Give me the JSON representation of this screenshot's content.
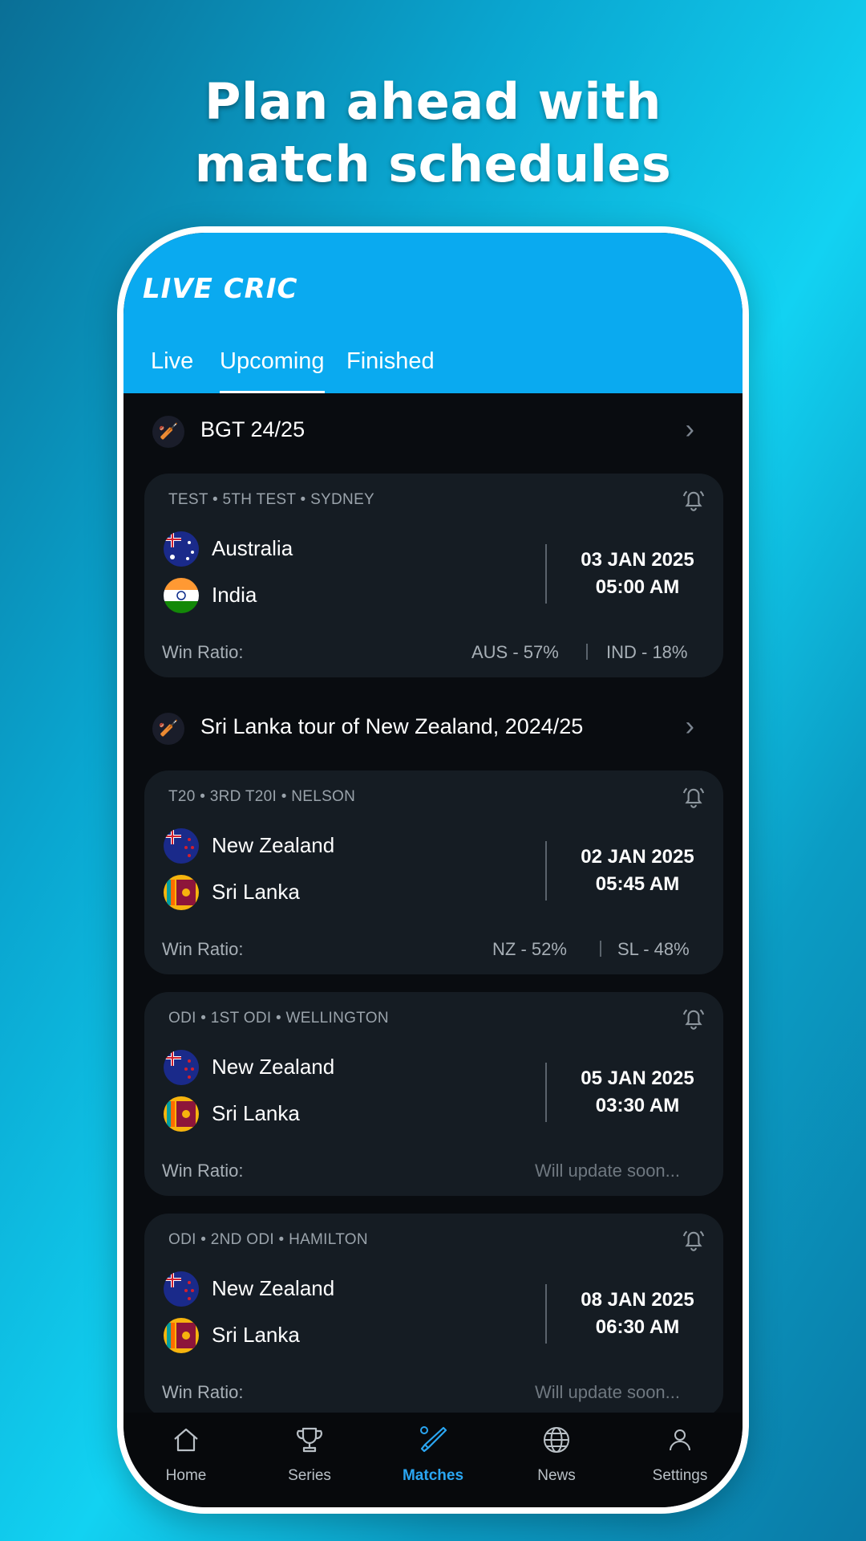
{
  "promo": {
    "headline_line1": "Plan ahead with",
    "headline_line2": "match schedules"
  },
  "colors": {
    "header_bg": "#0aaaf0",
    "accent": "#2aa6f2",
    "card_bg": "#151c23",
    "content_bg": "#090c10"
  },
  "app": {
    "logo": "LIVE CRIC"
  },
  "tabs": [
    {
      "label": "Live",
      "active": false
    },
    {
      "label": "Upcoming",
      "active": true
    },
    {
      "label": "Finished",
      "active": false
    }
  ],
  "series": [
    {
      "title": "BGT 24/25",
      "icon": "cricket-series-icon",
      "matches": [
        {
          "meta": "TEST  •  5TH TEST  • SYDNEY",
          "team1": {
            "name": "Australia",
            "flag": "australia-flag-icon"
          },
          "team2": {
            "name": "India",
            "flag": "india-flag-icon"
          },
          "date": "03 JAN 2025",
          "time": "05:00 AM",
          "win_label": "Win Ratio:",
          "win1": "AUS - 57%",
          "win2": "IND - 18%"
        }
      ]
    },
    {
      "title": "Sri Lanka tour of New Zealand, 2024/25",
      "icon": "cricket-series-icon",
      "matches": [
        {
          "meta": "T20  •  3RD T20I  • NELSON",
          "team1": {
            "name": "New Zealand",
            "flag": "new-zealand-flag-icon"
          },
          "team2": {
            "name": "Sri Lanka",
            "flag": "sri-lanka-flag-icon"
          },
          "date": "02 JAN 2025",
          "time": "05:45 AM",
          "win_label": "Win Ratio:",
          "win1": "NZ - 52%",
          "win2": "SL - 48%"
        },
        {
          "meta": "ODI  •  1ST ODI  • WELLINGTON",
          "team1": {
            "name": "New Zealand",
            "flag": "new-zealand-flag-icon"
          },
          "team2": {
            "name": "Sri Lanka",
            "flag": "sri-lanka-flag-icon"
          },
          "date": "05 JAN 2025",
          "time": "03:30 AM",
          "win_label": "Win Ratio:",
          "win_status": "Will update soon..."
        },
        {
          "meta": "ODI  •  2ND ODI  • HAMILTON",
          "team1": {
            "name": "New Zealand",
            "flag": "new-zealand-flag-icon"
          },
          "team2": {
            "name": "Sri Lanka",
            "flag": "sri-lanka-flag-icon"
          },
          "date": "08 JAN 2025",
          "time": "06:30 AM",
          "win_label": "Win Ratio:",
          "win_status": "Will update soon..."
        }
      ]
    }
  ],
  "bottom_nav": [
    {
      "label": "Home",
      "icon": "home-icon",
      "active": false
    },
    {
      "label": "Series",
      "icon": "trophy-icon",
      "active": false
    },
    {
      "label": "Matches",
      "icon": "cricket-bat-icon",
      "active": true
    },
    {
      "label": "News",
      "icon": "globe-icon",
      "active": false
    },
    {
      "label": "Settings",
      "icon": "user-icon",
      "active": false
    }
  ]
}
